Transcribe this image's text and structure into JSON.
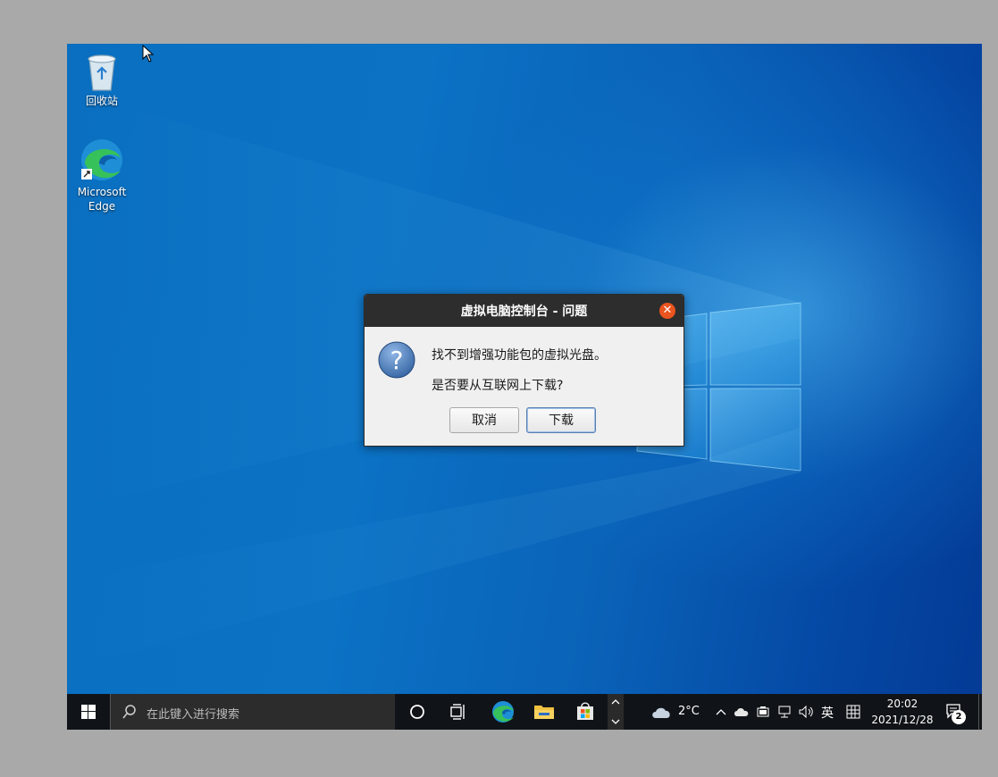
{
  "desktop": {
    "icons": [
      {
        "label": "回收站",
        "icon": "recycle-bin-icon"
      },
      {
        "label": "Microsoft Edge",
        "icon": "edge-icon"
      }
    ]
  },
  "dialog": {
    "title": "虚拟电脑控制台 - 问题",
    "message_line1": "找不到增强功能包的虚拟光盘。",
    "message_line2": "是否要从互联网上下载?",
    "cancel_label": "取消",
    "download_label": "下载",
    "close_glyph": "✕",
    "colors": {
      "titlebar": "#2d2d2d",
      "close": "#e9541f"
    }
  },
  "taskbar": {
    "search_placeholder": "在此键入进行搜索",
    "apps": [
      "cortana-icon",
      "task-view-icon",
      "edge-icon",
      "file-explorer-icon",
      "store-icon"
    ],
    "weather": "2°C",
    "ime": "英",
    "time": "20:02",
    "date": "2021/12/28",
    "notification_count": "2"
  }
}
